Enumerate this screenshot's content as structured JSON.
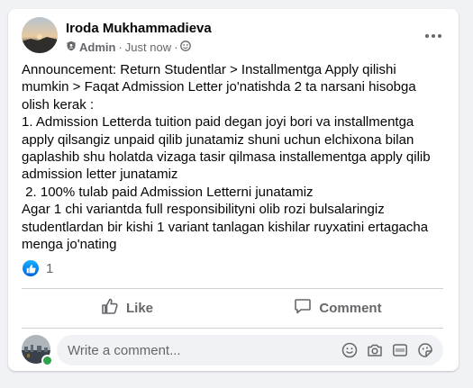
{
  "post": {
    "author": "Iroda Mukhammadieva",
    "role": "Admin",
    "time": "Just now",
    "separator": "·",
    "text": "Announcement: Return Studentlar > Installmentga Apply qilishi\nmumkin > Faqat Admission Letter jo'natishda 2 ta narsani hisobga\nolish kerak :\n1. Admission Letterda tuition paid degan joyi bori va installmentga\napply qilsangiz unpaid qilib junatamiz shuni uchun elchixona bilan\ngaplashib shu holatda vizaga tasir qilmasa installementga apply qilib\nadmission letter junatamiz\n 2. 100% tulab paid Admission Letterni junatamiz\nAgar 1 chi variantda full responsibilityni olib rozi bulsalaringiz\nstudentlardan bir kishi 1 variant tanlagan kishilar ruyxatini ertagacha\nmenga jo'nating",
    "reaction_count": "1"
  },
  "actions": {
    "like_label": "Like",
    "comment_label": "Comment"
  },
  "comment": {
    "placeholder": "Write a comment..."
  },
  "colors": {
    "accent": "#1877f2",
    "online": "#31a24c",
    "secondary_text": "#65676b"
  }
}
